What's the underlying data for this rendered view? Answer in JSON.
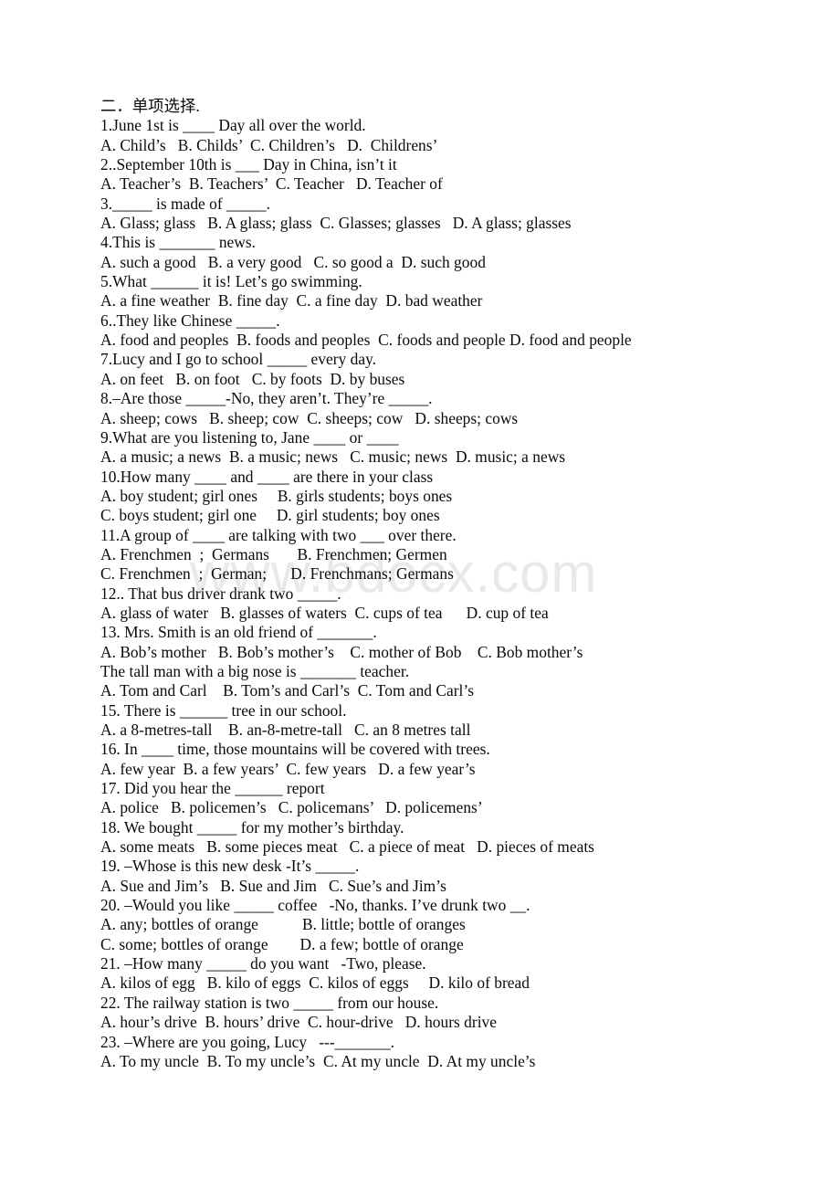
{
  "document": {
    "watermark": "www.bdocx.com",
    "heading": "二．单项选择.",
    "lines": [
      "1.June 1st is ____ Day all over the world.",
      "A. Child’s   B. Childs’  C. Children’s   D.  Childrens’",
      "2..September 10th is ___ Day in China, isn’t it",
      "A. Teacher’s  B. Teachers’  C. Teacher   D. Teacher of",
      "3._____ is made of _____.",
      "A. Glass; glass   B. A glass; glass  C. Glasses; glasses   D. A glass; glasses",
      "4.This is _______ news.",
      "A. such a good   B. a very good   C. so good a  D. such good",
      "5.What ______ it is! Let’s go swimming.",
      "A. a fine weather  B. fine day  C. a fine day  D. bad weather",
      "6..They like Chinese _____.",
      "A. food and peoples  B. foods and peoples  C. foods and people D. food and people",
      "7.Lucy and I go to school _____ every day.",
      "A. on feet   B. on foot   C. by foots  D. by buses",
      "8.–Are those _____-No, they aren’t. They’re _____.",
      "A. sheep; cows   B. sheep; cow  C. sheeps; cow   D. sheeps; cows",
      "9.What are you listening to, Jane ____ or ____",
      "A. a music; a news  B. a music; news   C. music; news  D. music; a news",
      "10.How many ____ and ____ are there in your class",
      "A. boy student; girl ones     B. girls students; boys ones",
      "C. boys student; girl one     D. girl students; boy ones",
      "11.A group of ____ are talking with two ___ over there.",
      "A. Frenchmen  ;  Germans       B. Frenchmen; Germen",
      "C. Frenchmen  ;  German;      D. Frenchmans; Germans",
      "12.. That bus driver drank two _____.",
      "A. glass of water   B. glasses of waters  C. cups of tea      D. cup of tea",
      "13. Mrs. Smith is an old friend of _______.",
      "A. Bob’s mother   B. Bob’s mother’s    C. mother of Bob    C. Bob mother’s",
      "The tall man with a big nose is _______ teacher.",
      "A. Tom and Carl    B. Tom’s and Carl’s  C. Tom and Carl’s",
      "15. There is ______ tree in our school.",
      "A. a 8-metres-tall    B. an-8-metre-tall   C. an 8 metres tall",
      "16. In ____ time, those mountains will be covered with trees.",
      "A. few year  B. a few years’  C. few years   D. a few year’s",
      "17. Did you hear the ______ report",
      "A. police   B. policemen’s   C. policemans’   D. policemens’",
      "18. We bought _____ for my mother’s birthday.",
      "A. some meats   B. some pieces meat   C. a piece of meat   D. pieces of meats",
      "19. –Whose is this new desk -It’s _____.",
      "A. Sue and Jim’s   B. Sue and Jim   C. Sue’s and Jim’s",
      "20. –Would you like _____ coffee   -No, thanks. I’ve drunk two __.",
      "A. any; bottles of orange           B. little; bottle of oranges",
      "C. some; bottles of orange        D. a few; bottle of orange",
      "21. –How many _____ do you want   -Two, please.",
      "A. kilos of egg   B. kilo of eggs  C. kilos of eggs     D. kilo of bread",
      "22. The railway station is two _____ from our house.",
      "A. hour’s drive  B. hours’ drive  C. hour-drive   D. hours drive",
      "23. –Where are you going, Lucy   ---_______.",
      "A. To my uncle  B. To my uncle’s  C. At my uncle  D. At my uncle’s"
    ]
  },
  "colors": {
    "page_background": "#ffffff",
    "text": "#0a0a0a",
    "watermark": "#e9e9e9"
  }
}
